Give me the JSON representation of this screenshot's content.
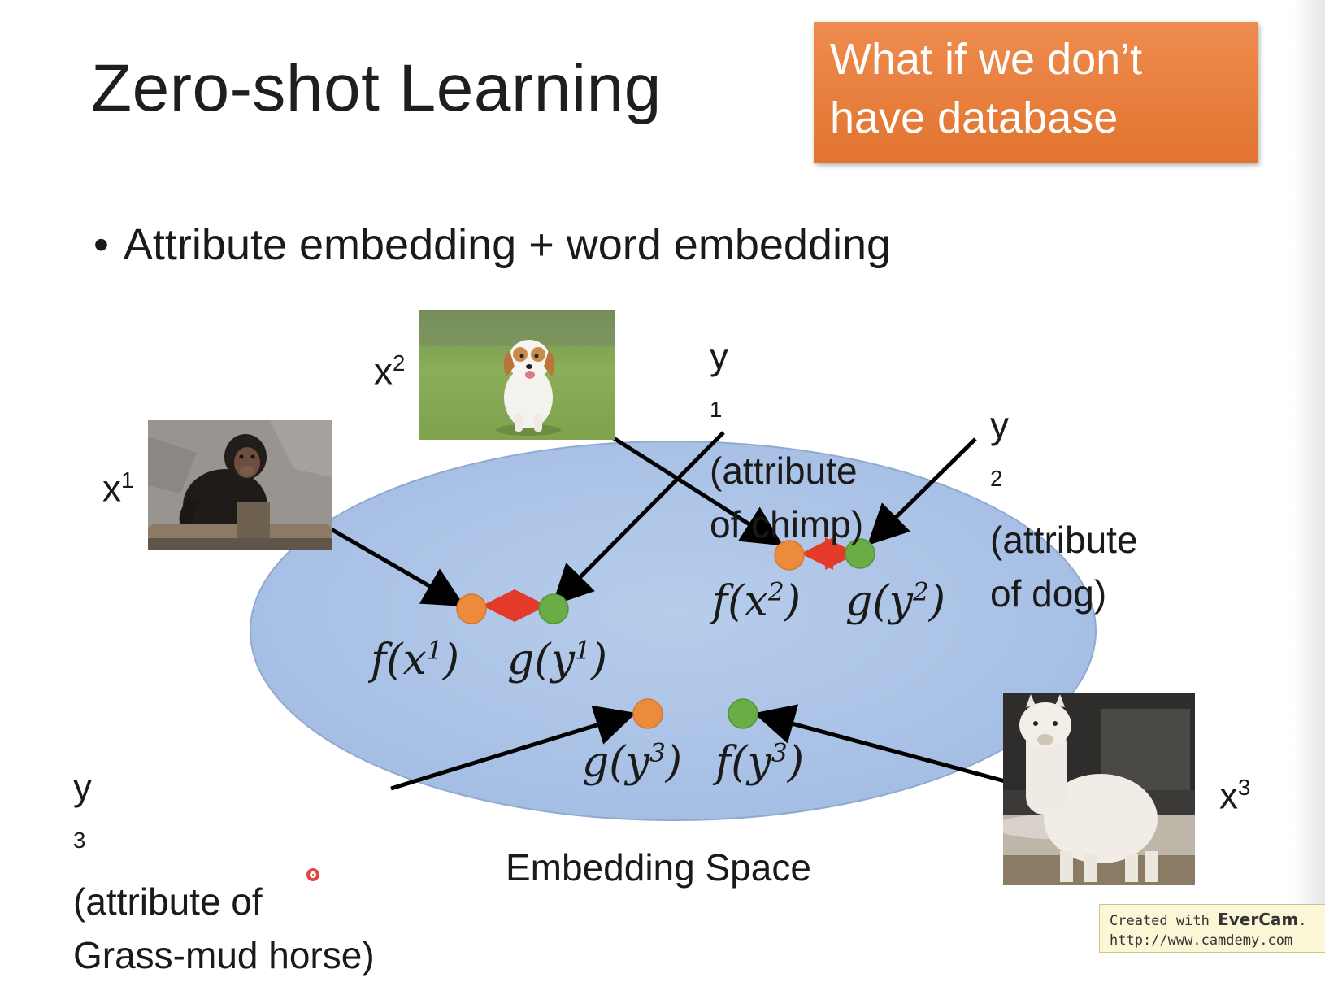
{
  "slide": {
    "title": "Zero-shot Learning",
    "callout": {
      "line1": "What if we don’t",
      "line2": "have database"
    },
    "bullet": "Attribute embedding + word embedding",
    "embedding_space_label": "Embedding Space"
  },
  "labels": {
    "x1": {
      "base": "x",
      "sup": "1"
    },
    "x2": {
      "base": "x",
      "sup": "2"
    },
    "x3": {
      "base": "x",
      "sup": "3"
    },
    "y1": {
      "base": "y",
      "sup": "1",
      "line1": "(attribute",
      "line2": "of chimp)"
    },
    "y2": {
      "base": "y",
      "sup": "2",
      "line1": "(attribute",
      "line2": "of dog)"
    },
    "y3": {
      "base": "y",
      "sup": "3",
      "line1": "(attribute of",
      "line2": "Grass-mud horse)"
    }
  },
  "math": {
    "f_x1": {
      "pre": "f(x",
      "sup": "1",
      "post": ")"
    },
    "g_y1": {
      "pre": "g(y",
      "sup": "1",
      "post": ")"
    },
    "f_x2": {
      "pre": "f(x",
      "sup": "2",
      "post": ")"
    },
    "g_y2": {
      "pre": "g(y",
      "sup": "2",
      "post": ")"
    },
    "g_y3": {
      "pre": "g(y",
      "sup": "3",
      "post": ")"
    },
    "f_y3": {
      "pre": "f(y",
      "sup": "3",
      "post": ")"
    }
  },
  "images": {
    "chimp": "chimpanzee-photo",
    "dog": "puppy-photo",
    "alpaca": "alpaca-photo"
  },
  "colors": {
    "ellipse_fill": "#a9c2e6",
    "ellipse_stroke": "#8fa9d1",
    "orange_dot": "#ed8b3d",
    "green_dot": "#6aac45",
    "double_arrow": "#e43a2a",
    "arrow": "#000000",
    "callout": "#e8803e"
  },
  "footer": {
    "created_with": "Created with",
    "brand": "EverCam",
    "url": "http://www.camdemy.com"
  }
}
